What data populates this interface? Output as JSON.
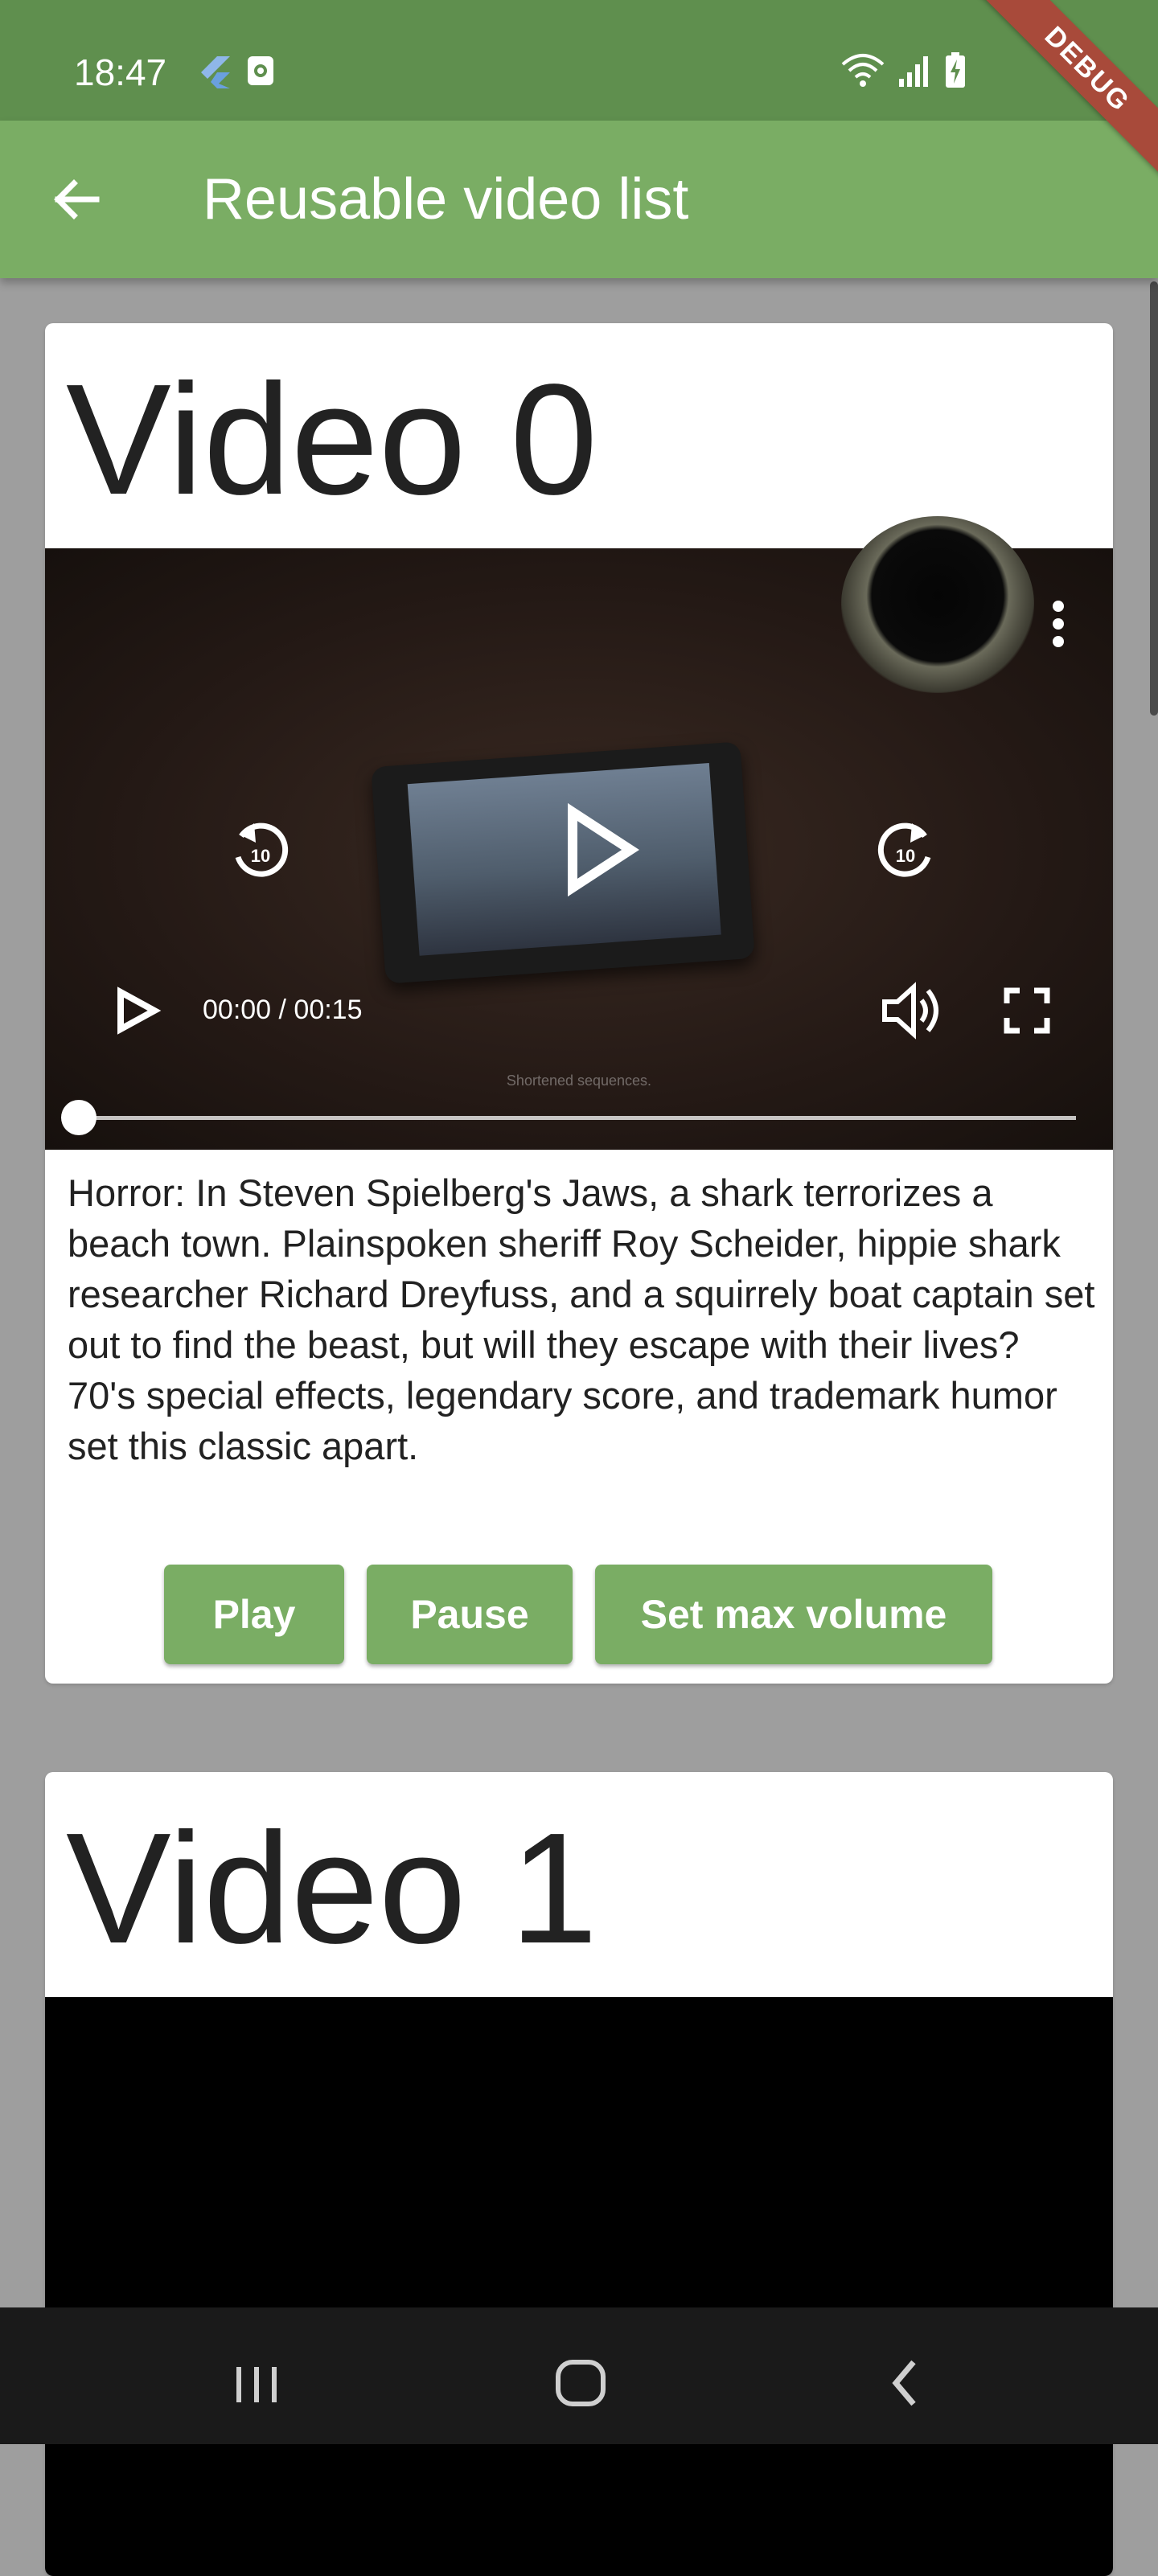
{
  "status_bar": {
    "time": "18:47",
    "left_icons": [
      "flutter-icon",
      "screenshot-icon"
    ],
    "right_icons": [
      "wifi-icon",
      "signal-icon",
      "battery-charging-icon"
    ],
    "debug_banner": "DEBUG"
  },
  "app_bar": {
    "back_icon": "arrow-back-icon",
    "title": "Reusable video list"
  },
  "videos": [
    {
      "title": "Video 0",
      "caption": "Shortened sequences.",
      "time": "00:00 / 00:15",
      "progress": 0,
      "description": "Horror: In Steven Spielberg's Jaws, a shark terrorizes a beach town. Plainspoken sheriff Roy Scheider, hippie shark researcher Richard Dreyfuss, and a squirrely boat captain set out to find the beast, but will they escape with their lives? 70's special effects, legendary score, and trademark humor set this classic apart.",
      "controls": {
        "more_icon": "more-vert-icon",
        "rewind_icon": "replay-10-icon",
        "play_icon": "play-icon",
        "forward_icon": "forward-10-icon",
        "volume_icon": "volume-up-icon",
        "fullscreen_icon": "fullscreen-icon"
      },
      "buttons": {
        "play": "Play",
        "pause": "Pause",
        "max_volume": "Set max volume"
      }
    },
    {
      "title": "Video 1",
      "state": "loading"
    }
  ],
  "nav_bar": {
    "icons": [
      "recents-icon",
      "home-icon",
      "back-icon"
    ]
  },
  "colors": {
    "status_bar": "#5f8f4e",
    "app_bar": "#7aad64",
    "button": "#7aad64",
    "background": "#9e9e9e",
    "debug_banner": "#a84a3a"
  }
}
